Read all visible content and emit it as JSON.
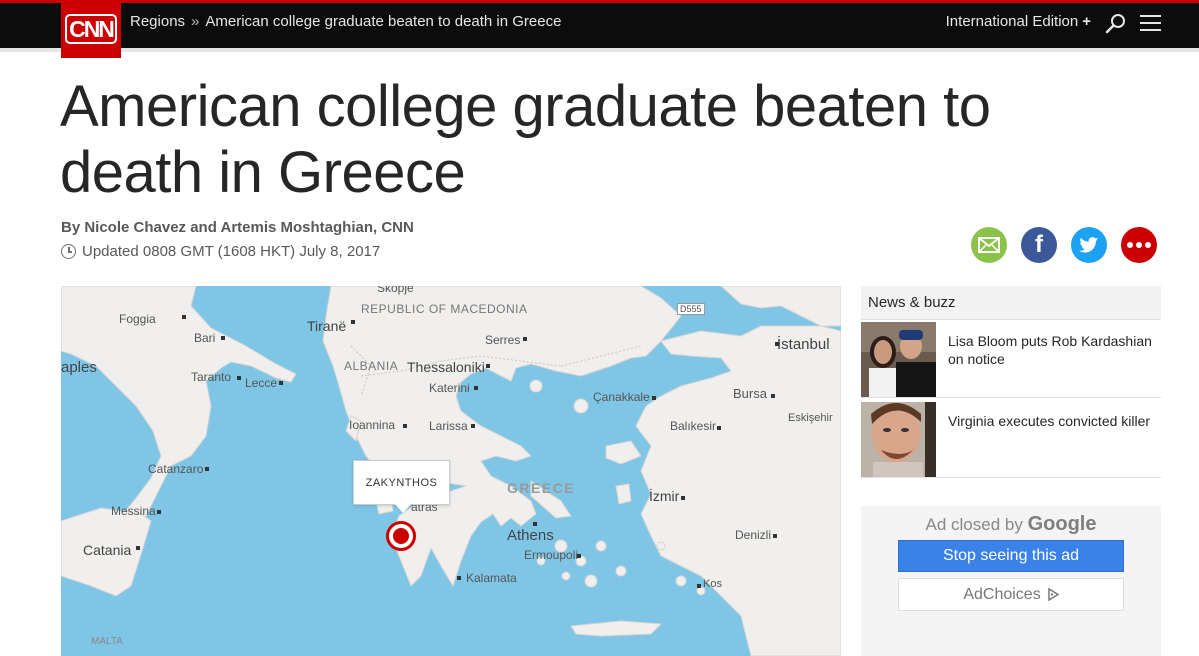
{
  "nav": {
    "logo_text": "CNN",
    "breadcrumb_section": "Regions",
    "breadcrumb_separator": "»",
    "breadcrumb_current": "American college graduate beaten to death in Greece",
    "edition": "International Edition",
    "edition_plus": "+",
    "search_icon": "search-icon",
    "menu_icon": "hamburger-menu-icon"
  },
  "article": {
    "headline": "American college graduate beaten to death in Greece",
    "byline": "By Nicole Chavez and Artemis Moshtaghian, CNN",
    "updated": "Updated 0808 GMT (1608 HKT) July 8, 2017"
  },
  "share": {
    "icons": [
      "email-icon",
      "facebook-icon",
      "twitter-icon",
      "more-icon"
    ],
    "facebook_glyph": "f"
  },
  "map": {
    "callout": "ZAKYNTHOS",
    "labels": {
      "skopje": "Skopje",
      "macedonia": "REPUBLIC OF MACEDONIA",
      "d555": "D555",
      "foggia": "Foggia",
      "tirane": "Tiranë",
      "bari": "Bari",
      "serres": "Serres",
      "istanbul": "İstanbul",
      "naples": "aples",
      "albania": "ALBANIA",
      "thessaloniki": "Thessaloniki",
      "taranto": "Taranto",
      "lecce": "Lecce",
      "katerini": "Katerini",
      "canakkale": "Çanakkale",
      "bursa": "Bursa",
      "eskisehir": "Eskişehir",
      "ioannina": "Ioannina",
      "larissa": "Larissa",
      "balikesir": "Balıkesir",
      "catanzaro": "Catanzaro",
      "greece": "GREECE",
      "patras": "atras",
      "izmir": "İzmir",
      "messina": "Messina",
      "athens": "Athens",
      "denizli": "Denizli",
      "catania": "Catania",
      "ermoupoli": "Ermoupoli",
      "kalamata": "Kalamata",
      "kos": "Kos",
      "malta": "MALTA"
    }
  },
  "sidebar": {
    "header": "News & buzz",
    "items": [
      {
        "title": "Lisa Bloom puts Rob Kardashian on notice"
      },
      {
        "title": "Virginia executes convicted killer"
      }
    ]
  },
  "ad": {
    "closed_prefix": "Ad closed by",
    "closed_brand": "Google",
    "stop_button": "Stop seeing this ad",
    "adchoices": "AdChoices",
    "adchoices_icon": "adchoices-icon"
  },
  "colors": {
    "brand_red": "#cc0000",
    "nav_bg": "#0c0c0c",
    "sea": "#7fc6e6",
    "land": "#f0efed",
    "ad_button": "#3b82e8"
  }
}
